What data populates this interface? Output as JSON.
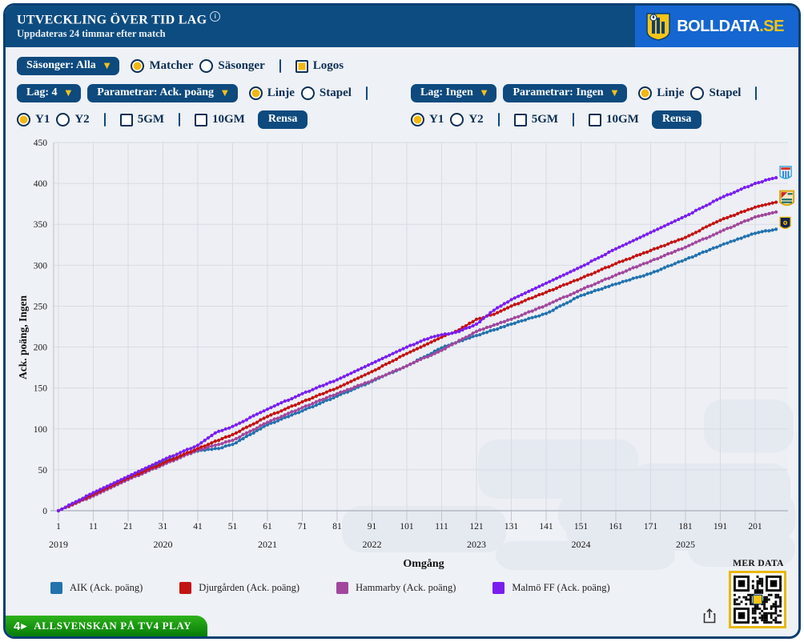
{
  "header": {
    "title": "UTVECKLING ÖVER TID LAG",
    "info_icon": "i",
    "subtitle": "Uppdateras 24 timmar efter match",
    "brand": {
      "name": "BOLLDATA",
      "tld": ".SE"
    }
  },
  "filters": {
    "season_dropdown": "Säsonger: Alla",
    "caret": "▼",
    "matcher_label": "Matcher",
    "sasonger_label": "Säsonger",
    "logos_label": "Logos",
    "groups": [
      {
        "lag_dropdown": "Lag: 4",
        "param_dropdown": "Parametrar: Ack. poäng",
        "linje_label": "Linje",
        "stapel_label": "Stapel",
        "y1_label": "Y1",
        "y2_label": "Y2",
        "gm5_label": "5GM",
        "gm10_label": "10GM",
        "clear_label": "Rensa"
      },
      {
        "lag_dropdown": "Lag: Ingen",
        "param_dropdown": "Parametrar: Ingen",
        "linje_label": "Linje",
        "stapel_label": "Stapel",
        "y1_label": "Y1",
        "y2_label": "Y2",
        "gm5_label": "5GM",
        "gm10_label": "10GM",
        "clear_label": "Rensa"
      }
    ]
  },
  "chart_data": {
    "type": "line",
    "xlabel": "Omgång",
    "ylabel": "Ack. poäng, Ingen",
    "ylim": [
      0,
      450
    ],
    "y_tick_step": 50,
    "x_ticks": [
      1,
      11,
      21,
      31,
      41,
      51,
      61,
      71,
      81,
      91,
      101,
      111,
      121,
      131,
      141,
      151,
      161,
      171,
      181,
      191,
      201
    ],
    "x_range": [
      1,
      207
    ],
    "grid": true,
    "legend_position": "bottom",
    "seasons": [
      {
        "year": "2019",
        "round": 1
      },
      {
        "year": "2020",
        "round": 31
      },
      {
        "year": "2021",
        "round": 61
      },
      {
        "year": "2022",
        "round": 91
      },
      {
        "year": "2023",
        "round": 121
      },
      {
        "year": "2024",
        "round": 151
      },
      {
        "year": "2025",
        "round": 181
      }
    ],
    "series": [
      {
        "name": "AIK",
        "legend": "AIK (Ack. poäng)",
        "color": "#2272ae",
        "crest": "aik",
        "keypoints": [
          [
            1,
            0
          ],
          [
            11,
            21
          ],
          [
            21,
            41
          ],
          [
            31,
            60
          ],
          [
            41,
            73
          ],
          [
            47,
            76
          ],
          [
            51,
            81
          ],
          [
            61,
            105
          ],
          [
            71,
            122
          ],
          [
            81,
            140
          ],
          [
            91,
            158
          ],
          [
            101,
            177
          ],
          [
            111,
            199
          ],
          [
            121,
            214
          ],
          [
            131,
            228
          ],
          [
            141,
            241
          ],
          [
            151,
            263
          ],
          [
            161,
            277
          ],
          [
            171,
            290
          ],
          [
            181,
            307
          ],
          [
            191,
            324
          ],
          [
            201,
            339
          ],
          [
            207,
            344
          ]
        ]
      },
      {
        "name": "Djurgården",
        "legend": "Djurgården (Ack. poäng)",
        "color": "#c31313",
        "crest": "dif",
        "keypoints": [
          [
            1,
            0
          ],
          [
            11,
            20
          ],
          [
            21,
            40
          ],
          [
            31,
            58
          ],
          [
            41,
            76
          ],
          [
            51,
            93
          ],
          [
            61,
            115
          ],
          [
            71,
            133
          ],
          [
            81,
            150
          ],
          [
            91,
            170
          ],
          [
            101,
            192
          ],
          [
            111,
            212
          ],
          [
            116,
            221
          ],
          [
            121,
            234
          ],
          [
            126,
            240
          ],
          [
            131,
            250
          ],
          [
            141,
            267
          ],
          [
            151,
            284
          ],
          [
            161,
            302
          ],
          [
            171,
            318
          ],
          [
            181,
            334
          ],
          [
            191,
            355
          ],
          [
            201,
            371
          ],
          [
            207,
            377
          ]
        ]
      },
      {
        "name": "Hammarby",
        "legend": "Hammarby (Ack. poäng)",
        "color": "#a1479d",
        "crest": "",
        "keypoints": [
          [
            1,
            0
          ],
          [
            11,
            18
          ],
          [
            21,
            38
          ],
          [
            31,
            56
          ],
          [
            41,
            74
          ],
          [
            51,
            86
          ],
          [
            61,
            108
          ],
          [
            71,
            126
          ],
          [
            81,
            143
          ],
          [
            91,
            159
          ],
          [
            101,
            177
          ],
          [
            111,
            196
          ],
          [
            121,
            219
          ],
          [
            131,
            234
          ],
          [
            141,
            251
          ],
          [
            151,
            270
          ],
          [
            161,
            288
          ],
          [
            171,
            305
          ],
          [
            181,
            322
          ],
          [
            191,
            341
          ],
          [
            201,
            359
          ],
          [
            207,
            365
          ]
        ]
      },
      {
        "name": "Malmö FF",
        "legend": "Malmö FF (Ack. poäng)",
        "color": "#7a1ef0",
        "crest": "mff",
        "keypoints": [
          [
            1,
            0
          ],
          [
            11,
            22
          ],
          [
            21,
            42
          ],
          [
            31,
            62
          ],
          [
            41,
            80
          ],
          [
            46,
            95
          ],
          [
            51,
            103
          ],
          [
            61,
            124
          ],
          [
            71,
            143
          ],
          [
            81,
            160
          ],
          [
            91,
            180
          ],
          [
            101,
            200
          ],
          [
            108,
            212
          ],
          [
            116,
            219
          ],
          [
            121,
            228
          ],
          [
            126,
            245
          ],
          [
            131,
            258
          ],
          [
            141,
            278
          ],
          [
            151,
            298
          ],
          [
            161,
            320
          ],
          [
            171,
            340
          ],
          [
            181,
            360
          ],
          [
            191,
            382
          ],
          [
            201,
            400
          ],
          [
            207,
            407
          ]
        ]
      }
    ]
  },
  "footer": {
    "tv4_badge": "4",
    "tv4_play": "▶",
    "tv4_label": "ALLSVENSKAN PÅ TV4 PLAY",
    "more_data_label": "MER DATA"
  }
}
